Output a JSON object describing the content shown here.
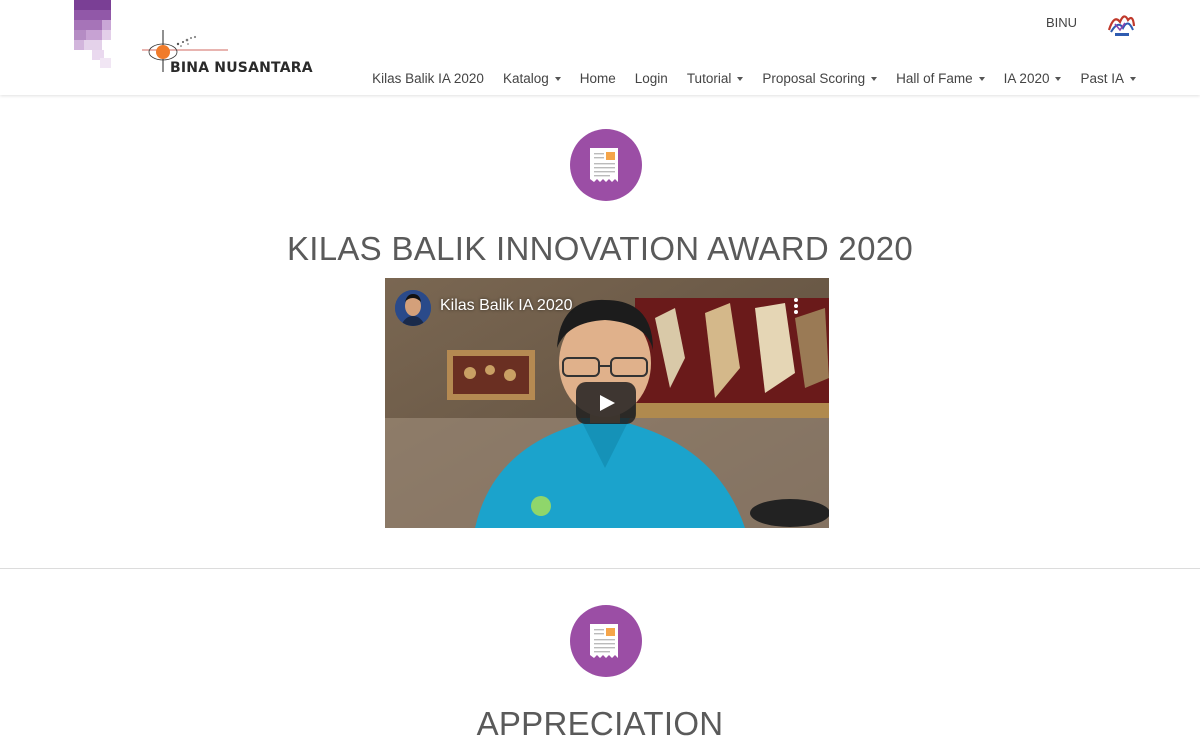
{
  "header": {
    "brand_text": "BINA NUSANTARA",
    "top_link": "BINU",
    "nav": [
      {
        "label": "Kilas Balik IA 2020",
        "dropdown": false
      },
      {
        "label": "Katalog",
        "dropdown": true
      },
      {
        "label": "Home",
        "dropdown": false
      },
      {
        "label": "Login",
        "dropdown": false
      },
      {
        "label": "Tutorial",
        "dropdown": true
      },
      {
        "label": "Proposal Scoring",
        "dropdown": true
      },
      {
        "label": "Hall of Fame",
        "dropdown": true
      },
      {
        "label": "IA 2020",
        "dropdown": true
      },
      {
        "label": "Past IA",
        "dropdown": true
      }
    ]
  },
  "section1": {
    "title": "KILAS BALIK INNOVATION AWARD 2020",
    "icon": "document-icon",
    "video": {
      "title": "Kilas Balik IA 2020",
      "play_icon": "play-icon",
      "menu_icon": "more-vertical-icon"
    }
  },
  "section2": {
    "title": "APPRECIATION",
    "icon": "document-icon"
  },
  "colors": {
    "accent": "#9b4ea5",
    "icon_orange": "#f5a54a",
    "text": "#555555",
    "divider": "#dcdcdc"
  }
}
